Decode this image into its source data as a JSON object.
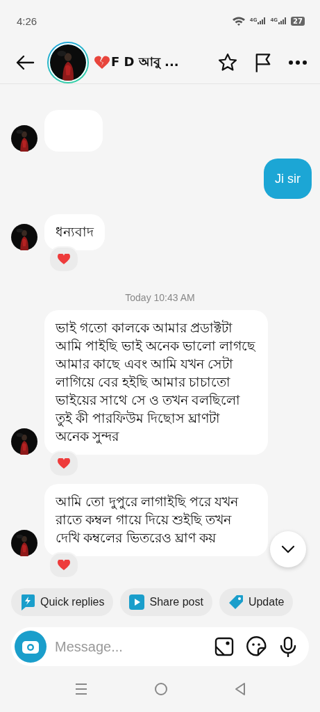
{
  "status_bar": {
    "time": "4:26",
    "sim_labels": [
      "4G",
      "4G"
    ],
    "battery": "27"
  },
  "header": {
    "title": "F D আবু ...",
    "story_ring": true
  },
  "messages": [
    {
      "kind": "partial"
    },
    {
      "kind": "outgoing",
      "text": "Ji sir"
    },
    {
      "kind": "incoming",
      "text": "ধন্যবাদ",
      "hearted": true
    },
    {
      "kind": "timestamp",
      "text": "Today 10:43 AM"
    },
    {
      "kind": "incoming",
      "text": "ভাই গতো কালকে আমার প্রডাক্টটা আমি পাইছি ভাই অনেক ভালো লাগছে আমার কাছে এবং আমি যখন সেটা লাগিয়ে বের হইছি আমার চাচাতো ভাইয়ের সাথে সে ও তখন বলছিলো তুই কী পারফিউম দিছোস ঘ্রাণটা অনেক সুন্দর",
      "hearted": true
    },
    {
      "kind": "incoming",
      "text": "আমি তো দুপুরে লাগাইছি পরে যখন রাতে কম্বল গায়ে দিয়ে শুইছি তখন দেখি কম্বলের ভিতরেও ঘ্রাণ কয়",
      "hearted": true
    }
  ],
  "chips": [
    {
      "kind": "quick",
      "label": "Quick replies"
    },
    {
      "kind": "share",
      "label": "Share post"
    },
    {
      "kind": "tag",
      "label": "Update"
    }
  ],
  "composer": {
    "placeholder": "Message..."
  }
}
